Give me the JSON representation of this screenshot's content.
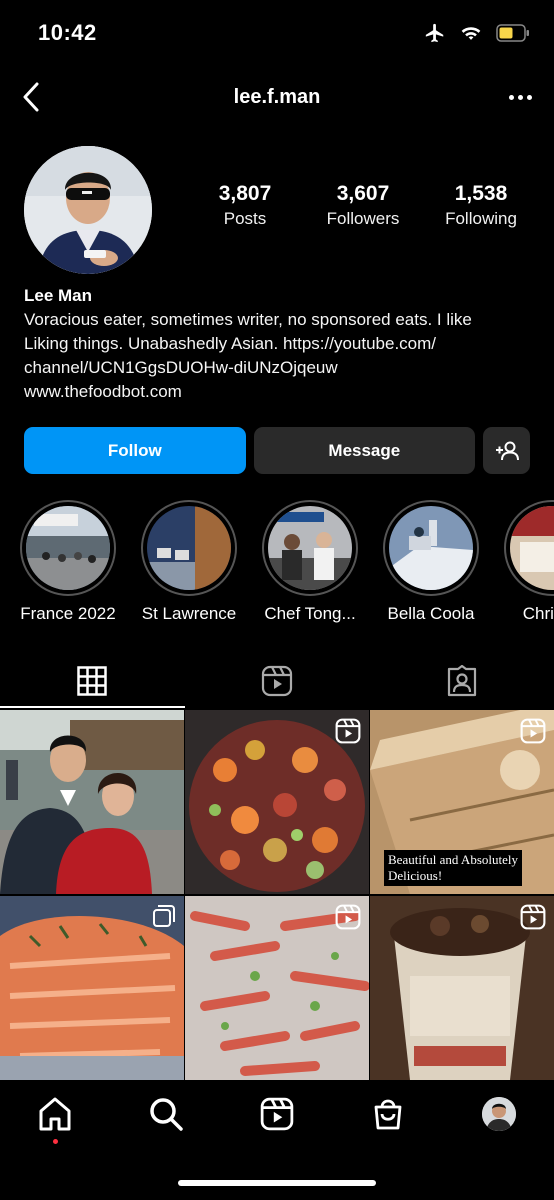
{
  "status_bar": {
    "time": "10:42",
    "icons": [
      "airplane-icon",
      "wifi-icon",
      "battery-icon"
    ],
    "battery_color": "#f7d54a"
  },
  "nav": {
    "username": "lee.f.man",
    "back_icon": "chevron-left-icon",
    "more_icon": "more-horizontal-icon"
  },
  "profile": {
    "stats": [
      {
        "num": "3,807",
        "label": "Posts"
      },
      {
        "num": "3,607",
        "label": "Followers"
      },
      {
        "num": "1,538",
        "label": "Following"
      }
    ],
    "name": "Lee Man",
    "bio_lines": [
      "Voracious eater, sometimes writer, no sponsored eats. I like",
      "Liking things. Unabashedly Asian. https://youtube.com/",
      "channel/UCN1GgsDUOHw-diUNzOjqeuw",
      "www.thefoodbot.com"
    ]
  },
  "actions": {
    "follow": "Follow",
    "message": "Message",
    "add_icon": "add-person-icon",
    "follow_color": "#0095f6"
  },
  "highlights": [
    {
      "label": "France 2022"
    },
    {
      "label": "St Lawrence"
    },
    {
      "label": "Chef Tong..."
    },
    {
      "label": "Bella Coola"
    },
    {
      "label": "Christm"
    }
  ],
  "tabs": [
    {
      "icon": "grid-icon",
      "active": true
    },
    {
      "icon": "reels-icon",
      "active": false
    },
    {
      "icon": "tagged-icon",
      "active": false
    }
  ],
  "grid": {
    "posts": [
      {
        "type": "photo"
      },
      {
        "type": "reel"
      },
      {
        "type": "reel",
        "caption": [
          "Beautiful and Absolutely",
          "Delicious!"
        ]
      },
      {
        "type": "carousel"
      },
      {
        "type": "reel"
      },
      {
        "type": "reel"
      }
    ]
  },
  "bottom_nav": [
    {
      "icon": "home-icon",
      "active": true
    },
    {
      "icon": "search-icon"
    },
    {
      "icon": "reels-icon"
    },
    {
      "icon": "shop-icon"
    },
    {
      "icon": "profile-avatar"
    }
  ]
}
